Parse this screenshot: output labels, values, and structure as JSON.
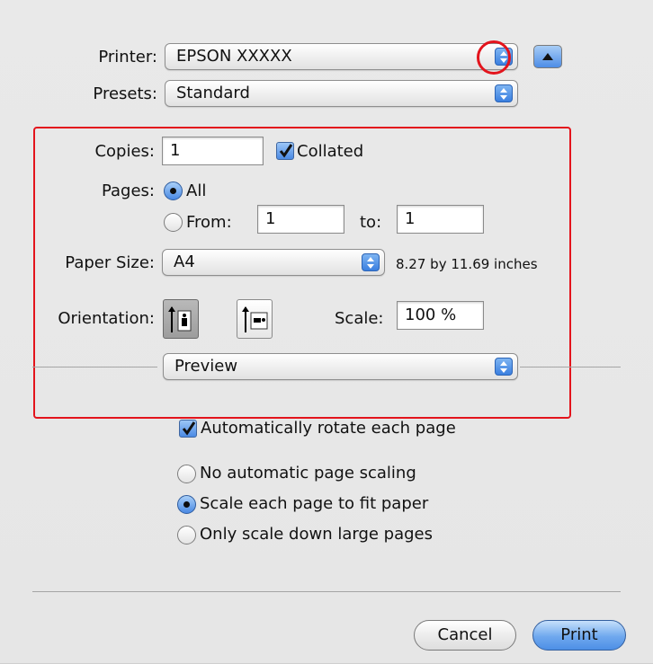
{
  "printer": {
    "label": "Printer:",
    "value": "EPSON XXXXX"
  },
  "presets": {
    "label": "Presets:",
    "value": "Standard"
  },
  "copies": {
    "label": "Copies:",
    "value": "1",
    "collated_label": "Collated",
    "collated_checked": true
  },
  "pages": {
    "label": "Pages:",
    "all_label": "All",
    "from_label": "From:",
    "from_value": "1",
    "to_label": "to:",
    "to_value": "1",
    "selected": "All"
  },
  "paper_size": {
    "label": "Paper Size:",
    "value": "A4",
    "dimensions": "8.27 by 11.69 inches"
  },
  "orientation": {
    "label": "Orientation:",
    "selected": "portrait"
  },
  "scale": {
    "label": "Scale:",
    "value": "100 %"
  },
  "section_popup": {
    "value": "Preview"
  },
  "preview": {
    "auto_rotate_label": "Automatically rotate each page",
    "auto_rotate_checked": true,
    "scaling_options": [
      {
        "label": "No automatic page scaling",
        "selected": false
      },
      {
        "label": "Scale each page to fit paper",
        "selected": true
      },
      {
        "label": "Only scale down large pages",
        "selected": false
      }
    ]
  },
  "buttons": {
    "cancel": "Cancel",
    "print": "Print"
  },
  "colors": {
    "highlight": "#e3141c",
    "accent_blue": "#4a89e3"
  }
}
